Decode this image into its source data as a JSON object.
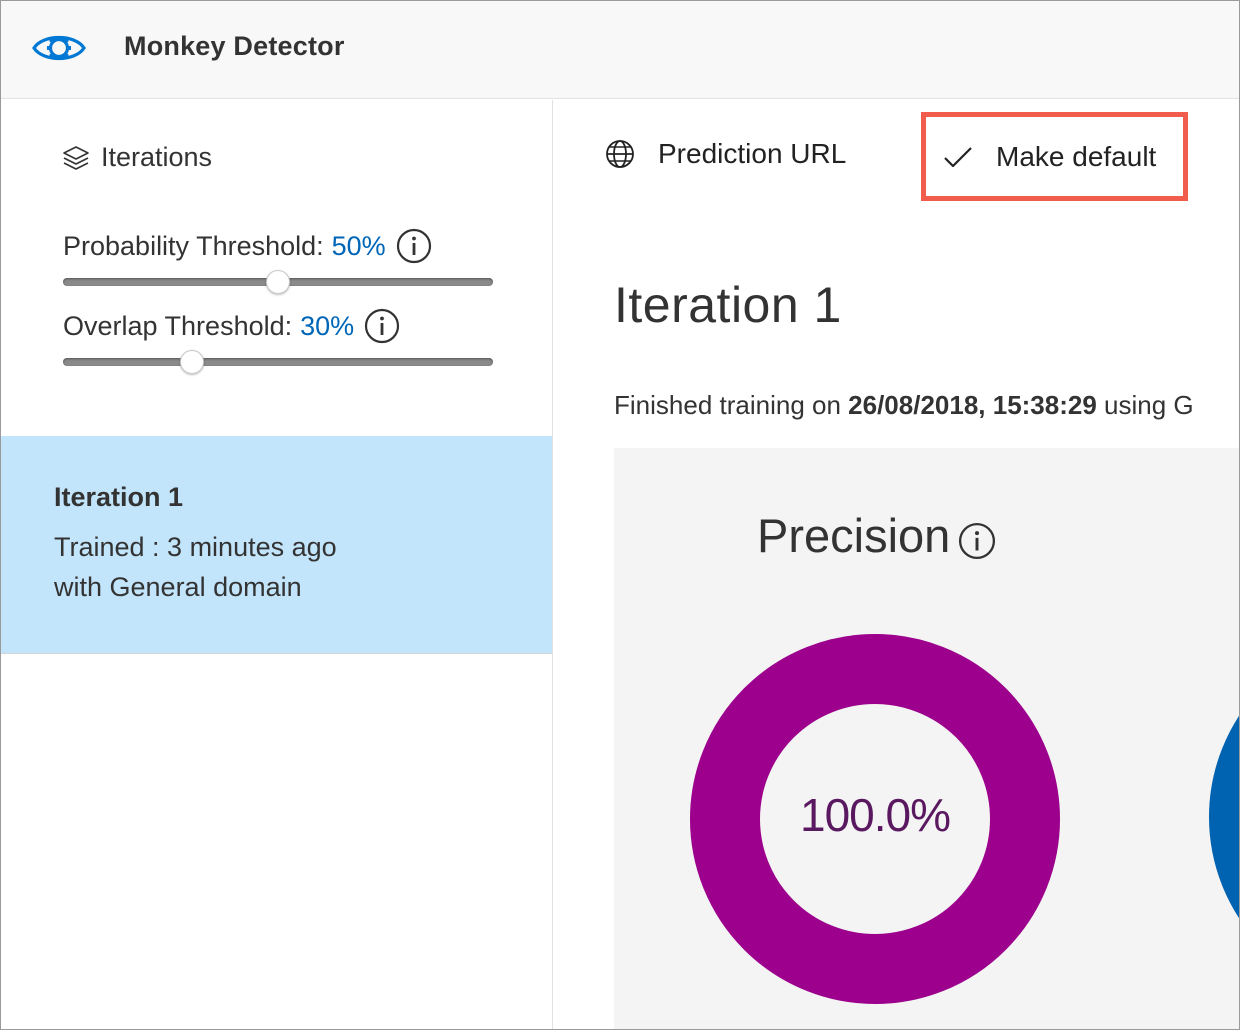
{
  "app": {
    "title": "Monkey Detector",
    "logo_icon": "eye-gear-icon",
    "accent_color": "#0078d4"
  },
  "sidebar": {
    "heading": "Iterations",
    "probability": {
      "label": "Probability Threshold:",
      "value": "50%",
      "fraction": 0.5
    },
    "overlap": {
      "label": "Overlap Threshold:",
      "value": "30%",
      "fraction": 0.3
    },
    "iterations": [
      {
        "name": "Iteration 1",
        "trained": "Trained : 3 minutes ago",
        "domain": "with General domain",
        "selected": true
      }
    ],
    "selected_color": "#c3e5fb"
  },
  "toolbar": {
    "prediction_url": "Prediction URL",
    "make_default": "Make default",
    "highlight_color": "#f25c4d"
  },
  "main": {
    "iteration_title": "Iteration 1",
    "finished_prefix": "Finished training on",
    "finished_date": "26/08/2018, 15:38:29",
    "finished_suffix": "using G",
    "precision": {
      "label": "Precision",
      "value_text": "100.0%",
      "value": 1.0,
      "color": "#9c008c"
    },
    "second_metric_color": "#0063b1"
  }
}
